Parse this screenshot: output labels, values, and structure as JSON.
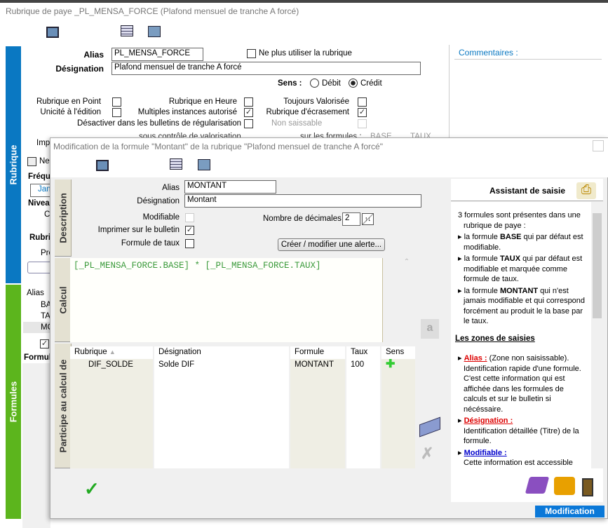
{
  "window": {
    "title": "Rubrique de paye _PL_MENSA_FORCE (Plafond mensuel de tranche A forcé)"
  },
  "rubrique": {
    "alias_label": "Alias",
    "alias_value": "PL_MENSA_FORCE",
    "ne_plus_label": "Ne plus utiliser la rubrique",
    "designation_label": "Désignation",
    "designation_value": "Plafond mensuel de tranche A forcé",
    "sens_label": "Sens :",
    "debit_label": "Débit",
    "credit_label": "Crédit",
    "sens_selected": "Crédit",
    "options": [
      {
        "label": "Rubrique en Point",
        "checked": false
      },
      {
        "label": "Rubrique en Heure",
        "checked": false
      },
      {
        "label": "Toujours Valorisée",
        "checked": false
      },
      {
        "label": "Unicité à l'édition",
        "checked": false
      },
      {
        "label": "Multiples instances autorisé",
        "checked": true
      },
      {
        "label": "Rubrique d'écrasement",
        "checked": true
      },
      {
        "label": "Désactiver dans les bulletins de régularisation",
        "checked": false
      },
      {
        "label": "Non saissable",
        "checked": false
      }
    ],
    "partial": {
      "sous_controle": "sous contrôle de valorisation",
      "sur_formules": "sur les formules :",
      "base": "BASE",
      "taux": "TAUX",
      "impr": "Impr",
      "ne": "Ne",
      "frequ": "Fréqu",
      "jan": "Jan",
      "nivea": "Nivea",
      "co": "Co",
      "rubri": "Rubri",
      "pro": "Pro",
      "alias": "Alias",
      "ba": "BA",
      "ta": "TA",
      "mo": "MO",
      "formul": "Formul"
    },
    "comments_label": "Commentaires :"
  },
  "sidebar": {
    "tabs": [
      {
        "label": "Rubrique",
        "color": "#0a78c2"
      },
      {
        "label": "Formules",
        "color": "#5cb51d"
      }
    ]
  },
  "dialog": {
    "title": "Modification de la formule \"Montant\" de la rubrique \"Plafond mensuel de tranche A forcé\"",
    "tabs": [
      "Description",
      "Calcul",
      "Participe au calcul de"
    ],
    "alias_label": "Alias",
    "alias_value": "MONTANT",
    "designation_label": "Désignation",
    "designation_value": "Montant",
    "modifiable_label": "Modifiable",
    "modifiable_checked": false,
    "imprimer_label": "Imprimer sur le bulletin",
    "imprimer_checked": true,
    "taux_label": "Formule de taux",
    "taux_checked": false,
    "decimales_label": "Nombre de décimales",
    "decimales_value": "2",
    "alerte_button": "Créer / modifier une alerte...",
    "formula": "[_PL_MENSA_FORCE.BASE] * [_PL_MENSA_FORCE.TAUX]",
    "table": {
      "headers": [
        "Rubrique",
        "Désignation",
        "Formule",
        "Taux",
        "Sens"
      ],
      "rows": [
        {
          "rubrique": "DIF_SOLDE",
          "designation": "Solde DIF",
          "formule": "MONTANT",
          "taux": "100",
          "sens": "plus-icon"
        }
      ]
    },
    "status": "Modification"
  },
  "assistant": {
    "title": "Assistant de saisie",
    "intro": "3 formules sont présentes dans une rubrique de paye :",
    "b1a": "la formule ",
    "b1b": "BASE",
    "b1c": " qui par défaut est modifiable.",
    "b2a": "la formule ",
    "b2b": "TAUX",
    "b2c": " qui par défaut est modifiable et marquée comme formule de taux.",
    "b3a": "la formule ",
    "b3b": "MONTANT",
    "b3c": " qui n'est jamais modifiable et qui correspond forcément au produit le la base par le taux.",
    "zones": "Les zones de saisies",
    "alias_h": "Alias :",
    "alias_t1": " (Zone non saisissable).",
    "alias_t2": "Identification rapide d'une formule. C'est cette information qui est affichée dans les formules de calculs et sur le bulletin si nécéssaire.",
    "desig_h": "Désignation :",
    "desig_t": "Identification détaillée (Titre) de la formule.",
    "modif_h": "Modifiable :",
    "modif_t": "Cette information est accessible pour les formules TAUX et BASE. Elle permet de définir si cette formule est modifiable ou non lors de la"
  }
}
